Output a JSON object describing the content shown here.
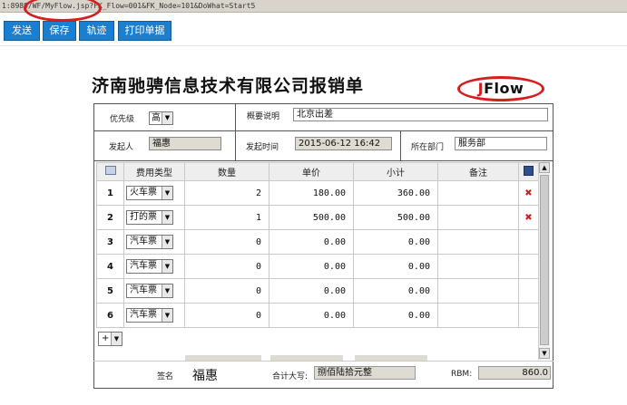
{
  "browser": {
    "url": "1:8989/WF/MyFlow.jsp?FK_Flow=001&FK_Node=101&DoWhat=Start5"
  },
  "toolbar": {
    "send": "发送",
    "save": "保存",
    "track": "轨迹",
    "print": "打印单据"
  },
  "form": {
    "title": "济南驰骋信息技术有限公司报销单",
    "logo": {
      "j": "J",
      "rest": "Flow"
    },
    "priority": {
      "label": "优先级",
      "value": "高"
    },
    "summary": {
      "label": "概要说明",
      "value": "北京出差"
    },
    "initiator": {
      "label": "发起人",
      "value": "福惠"
    },
    "start_time": {
      "label": "发起时间",
      "value": "2015-06-12 16:42"
    },
    "department": {
      "label": "所在部门",
      "value": "服务部"
    }
  },
  "table": {
    "headers": {
      "type": "费用类型",
      "qty": "数量",
      "price": "单价",
      "subtotal": "小计",
      "note": "备注"
    },
    "rows": [
      {
        "no": "1",
        "type": "火车票",
        "qty": "2",
        "price": "180.00",
        "subtotal": "360.00",
        "deletable": true
      },
      {
        "no": "2",
        "type": "打的票",
        "qty": "1",
        "price": "500.00",
        "subtotal": "500.00",
        "deletable": true
      },
      {
        "no": "3",
        "type": "汽车票",
        "qty": "0",
        "price": "0.00",
        "subtotal": "0.00",
        "deletable": false
      },
      {
        "no": "4",
        "type": "汽车票",
        "qty": "0",
        "price": "0.00",
        "subtotal": "0.00",
        "deletable": false
      },
      {
        "no": "5",
        "type": "汽车票",
        "qty": "0",
        "price": "0.00",
        "subtotal": "0.00",
        "deletable": false
      },
      {
        "no": "6",
        "type": "汽车票",
        "qty": "0",
        "price": "0.00",
        "subtotal": "0.00",
        "deletable": false
      }
    ],
    "add_row": "+",
    "delete_glyph": "✖"
  },
  "footer": {
    "sign_label": "签名",
    "sign_value": "福惠",
    "total_upper_label": "合计大写:",
    "total_upper_value": "捌佰陆拾元整",
    "rmb_label": "RBM:",
    "rmb_value": "860.0"
  },
  "colors": {
    "button": "#1a7ed1",
    "annotation": "#d51f1f",
    "readonly": "#dedbd2"
  },
  "icons": {
    "save": "floppy-disk-icon",
    "delete": "delete-x-icon",
    "select_all": "grid-icon"
  }
}
